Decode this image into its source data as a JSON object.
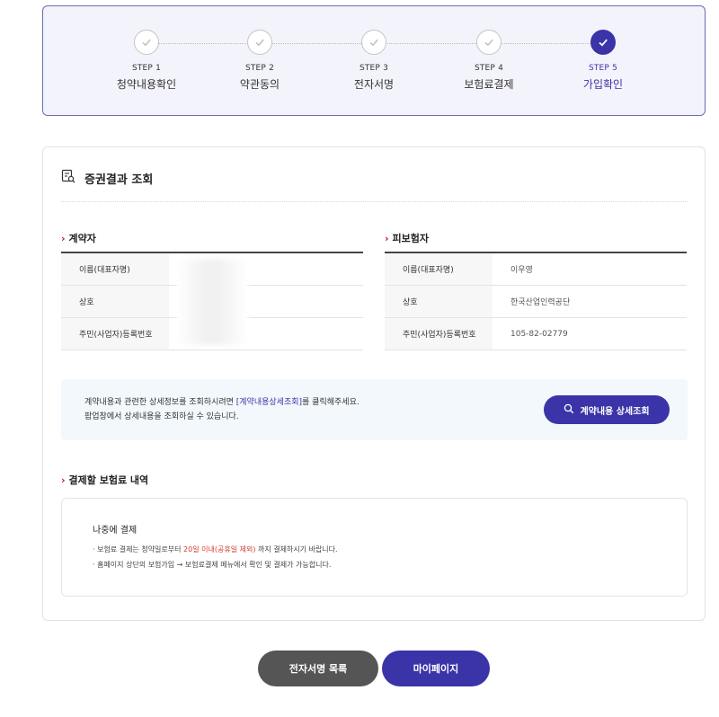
{
  "stepper": {
    "steps": [
      {
        "no": "STEP 1",
        "name": "청약내용확인",
        "done": true
      },
      {
        "no": "STEP 2",
        "name": "약관동의",
        "done": true
      },
      {
        "no": "STEP 3",
        "name": "전자서명",
        "done": true
      },
      {
        "no": "STEP 4",
        "name": "보험료결제",
        "done": true
      },
      {
        "no": "STEP 5",
        "name": "가입확인",
        "active": true
      }
    ]
  },
  "section": {
    "title": "증권결과 조회"
  },
  "contractor": {
    "heading": "계약자",
    "rows": [
      {
        "label": "이름(대표자명)",
        "value": ""
      },
      {
        "label": "상호",
        "value": ""
      },
      {
        "label": "주민(사업자)등록번호",
        "value": ""
      }
    ]
  },
  "insured": {
    "heading": "피보험자",
    "rows": [
      {
        "label": "이름(대표자명)",
        "value": "이우영"
      },
      {
        "label": "상호",
        "value": "한국산업인력공단"
      },
      {
        "label": "주민(사업자)등록번호",
        "value": "105-82-02779"
      }
    ]
  },
  "notice": {
    "line1_pre": "계약내용과 관련한 상세정보를 조회하시려면 ",
    "line1_link": "[계약내용상세조회]",
    "line1_post": "를 클릭해주세요.",
    "line2": "팝업창에서 상세내용을 조회하실 수 있습니다.",
    "button_label": "계약내용 상세조회"
  },
  "payment": {
    "heading": "결제할 보험료 내역",
    "box_title": "나중에 결제",
    "line1_pre": "· 보험료 결제는 청약일로부터 ",
    "line1_red": "20일 이내(공휴일 제외)",
    "line1_post": " 까지 결제하시기 바랍니다.",
    "line2": "· 홈페이지 상단의 보험가입 → 보험료결제 메뉴에서 확인 및 결제가 가능합니다."
  },
  "buttons": {
    "esign_list": "전자서명 목록",
    "mypage": "마이페이지"
  },
  "colors": {
    "accent": "#3b34a8",
    "arrow_red": "#c8102e",
    "highlight_red": "#d33a2c",
    "dark_button": "#555555"
  }
}
